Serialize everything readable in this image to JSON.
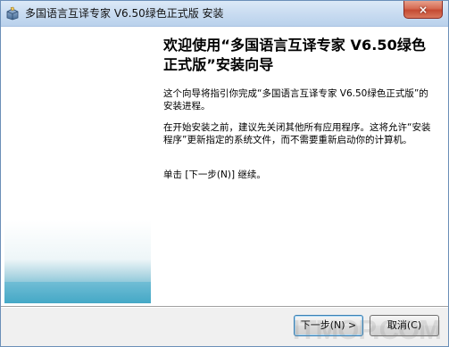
{
  "window": {
    "title": "多国语言互译专家 V6.50绿色正式版 安装",
    "close_icon": "×"
  },
  "wizard": {
    "heading": "欢迎使用“多国语言互译专家 V6.50绿色正式版”安装向导",
    "paragraph_1": "这个向导将指引你完成“多国语言互译专家 V6.50绿色正式版”的安装进程。",
    "paragraph_2": "在开始安装之前，建议先关闭其他所有应用程序。这将允许“安装程序”更新指定的系统文件，而不需要重新启动你的计算机。",
    "paragraph_3": "单击 [下一步(N)] 继续。"
  },
  "buttons": {
    "next": "下一步(N) >",
    "cancel": "取消(C)"
  },
  "watermark": {
    "text": "ITMOP.COM"
  },
  "colors": {
    "title_bar": "#c9dcf1",
    "close_button": "#c44a32",
    "sidebar_accent": "#49a9c6"
  },
  "icons": {
    "app": "installer-box-icon",
    "close": "close-icon"
  }
}
